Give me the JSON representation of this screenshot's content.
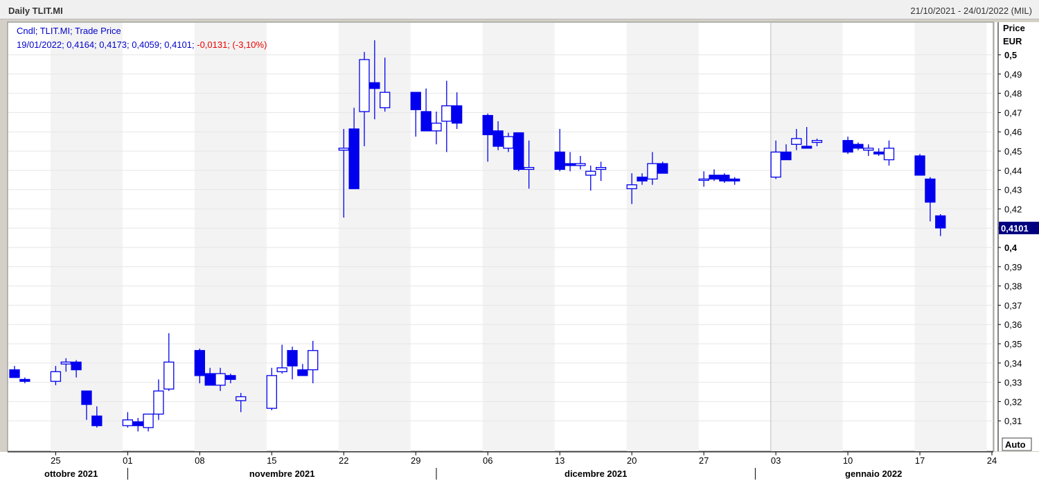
{
  "header": {
    "title": "Daily TLIT.MI",
    "range": "21/10/2021 - 24/01/2022 (MIL)"
  },
  "legend": {
    "line1": "Cndl; TLIT.MI; Trade Price",
    "line2_values": "19/01/2022; 0,4164; 0,4173; 0,4059; 0,4101; ",
    "line2_change": "-0,0131; (-3,10%)"
  },
  "price_axis": {
    "title": "Price",
    "currency": "EUR",
    "last_price": "0,4101",
    "auto_label": "Auto"
  },
  "colors": {
    "candle": "#0000ee",
    "legend_text": "#0000cc",
    "change_text": "#ee0000",
    "last_badge": "#000080"
  },
  "chart_data": {
    "type": "candlestick",
    "title": "Daily TLIT.MI",
    "ylabel": "Price EUR",
    "ylim": [
      0.3,
      0.505
    ],
    "xlim": [
      "2021-10-21",
      "2022-01-24"
    ],
    "y_ticks": [
      "0,31",
      "0,32",
      "0,33",
      "0,34",
      "0,35",
      "0,36",
      "0,37",
      "0,38",
      "0,39",
      "0,4",
      "0,41",
      "0,42",
      "0,43",
      "0,44",
      "0,45",
      "0,46",
      "0,47",
      "0,48",
      "0,49",
      "0,5"
    ],
    "y_ticks_bold": [
      "0,4",
      "0,5"
    ],
    "x_ticks": [
      {
        "date": "2021-10-25",
        "label": "25"
      },
      {
        "date": "2021-11-01",
        "label": "01"
      },
      {
        "date": "2021-11-08",
        "label": "08"
      },
      {
        "date": "2021-11-15",
        "label": "15"
      },
      {
        "date": "2021-11-22",
        "label": "22"
      },
      {
        "date": "2021-11-29",
        "label": "29"
      },
      {
        "date": "2021-12-06",
        "label": "06"
      },
      {
        "date": "2021-12-13",
        "label": "13"
      },
      {
        "date": "2021-12-20",
        "label": "20"
      },
      {
        "date": "2021-12-27",
        "label": "27"
      },
      {
        "date": "2022-01-03",
        "label": "03"
      },
      {
        "date": "2022-01-10",
        "label": "10"
      },
      {
        "date": "2022-01-17",
        "label": "17"
      },
      {
        "date": "2022-01-24",
        "label": "24"
      }
    ],
    "month_labels": [
      {
        "label": "ottobre 2021",
        "start": "2021-10-21",
        "end": "2021-11-01"
      },
      {
        "label": "novembre 2021",
        "start": "2021-11-01",
        "end": "2021-12-01"
      },
      {
        "label": "dicembre 2021",
        "start": "2021-12-01",
        "end": "2022-01-01"
      },
      {
        "label": "gennaio 2022",
        "start": "2022-01-01",
        "end": "2022-01-24"
      }
    ],
    "shaded_weeks": [
      "2021-10-25",
      "2021-11-08",
      "2021-11-22",
      "2021-12-06",
      "2021-12-20",
      "2022-01-03",
      "2022-01-17"
    ],
    "candles": [
      {
        "date": "2021-10-21",
        "open": 0.3365,
        "high": 0.3385,
        "low": 0.3325,
        "close": 0.3325
      },
      {
        "date": "2021-10-22",
        "open": 0.3315,
        "high": 0.3325,
        "low": 0.3295,
        "close": 0.3305
      },
      {
        "date": "2021-10-25",
        "open": 0.3305,
        "high": 0.3385,
        "low": 0.3285,
        "close": 0.3355
      },
      {
        "date": "2021-10-26",
        "open": 0.3395,
        "high": 0.3425,
        "low": 0.3355,
        "close": 0.3405
      },
      {
        "date": "2021-10-27",
        "open": 0.3405,
        "high": 0.3415,
        "low": 0.3325,
        "close": 0.3365
      },
      {
        "date": "2021-10-28",
        "open": 0.3255,
        "high": 0.3255,
        "low": 0.3105,
        "close": 0.3185
      },
      {
        "date": "2021-10-29",
        "open": 0.3125,
        "high": 0.3175,
        "low": 0.3065,
        "close": 0.3075
      },
      {
        "date": "2021-11-01",
        "open": 0.3075,
        "high": 0.3145,
        "low": 0.3065,
        "close": 0.3105
      },
      {
        "date": "2021-11-02",
        "open": 0.3095,
        "high": 0.3115,
        "low": 0.3045,
        "close": 0.3075
      },
      {
        "date": "2021-11-03",
        "open": 0.3065,
        "high": 0.3135,
        "low": 0.3045,
        "close": 0.3135
      },
      {
        "date": "2021-11-04",
        "open": 0.3135,
        "high": 0.3315,
        "low": 0.3105,
        "close": 0.3255
      },
      {
        "date": "2021-11-05",
        "open": 0.3265,
        "high": 0.3555,
        "low": 0.3255,
        "close": 0.3405
      },
      {
        "date": "2021-11-08",
        "open": 0.3465,
        "high": 0.3475,
        "low": 0.3295,
        "close": 0.3335
      },
      {
        "date": "2021-11-09",
        "open": 0.3345,
        "high": 0.3375,
        "low": 0.3285,
        "close": 0.3285
      },
      {
        "date": "2021-11-10",
        "open": 0.3285,
        "high": 0.3375,
        "low": 0.3255,
        "close": 0.3345
      },
      {
        "date": "2021-11-11",
        "open": 0.3335,
        "high": 0.3345,
        "low": 0.3295,
        "close": 0.3315
      },
      {
        "date": "2021-11-12",
        "open": 0.3205,
        "high": 0.3245,
        "low": 0.3145,
        "close": 0.3225
      },
      {
        "date": "2021-11-15",
        "open": 0.3165,
        "high": 0.3375,
        "low": 0.3155,
        "close": 0.3335
      },
      {
        "date": "2021-11-16",
        "open": 0.3355,
        "high": 0.3495,
        "low": 0.3345,
        "close": 0.3375
      },
      {
        "date": "2021-11-17",
        "open": 0.3465,
        "high": 0.3485,
        "low": 0.3315,
        "close": 0.3385
      },
      {
        "date": "2021-11-18",
        "open": 0.3365,
        "high": 0.3395,
        "low": 0.3335,
        "close": 0.3335
      },
      {
        "date": "2021-11-19",
        "open": 0.3365,
        "high": 0.3515,
        "low": 0.3295,
        "close": 0.3465
      },
      {
        "date": "2021-11-22",
        "open": 0.4505,
        "high": 0.4615,
        "low": 0.4155,
        "close": 0.4515
      },
      {
        "date": "2021-11-23",
        "open": 0.4615,
        "high": 0.4725,
        "low": 0.4305,
        "close": 0.4305
      },
      {
        "date": "2021-11-24",
        "open": 0.4705,
        "high": 0.5015,
        "low": 0.4525,
        "close": 0.4975
      },
      {
        "date": "2021-11-25",
        "open": 0.4855,
        "high": 0.5075,
        "low": 0.4665,
        "close": 0.4825
      },
      {
        "date": "2021-11-26",
        "open": 0.4725,
        "high": 0.4985,
        "low": 0.4705,
        "close": 0.4805
      },
      {
        "date": "2021-11-29",
        "open": 0.4805,
        "high": 0.4805,
        "low": 0.4575,
        "close": 0.4715
      },
      {
        "date": "2021-11-30",
        "open": 0.4705,
        "high": 0.4825,
        "low": 0.4605,
        "close": 0.4605
      },
      {
        "date": "2021-12-01",
        "open": 0.4605,
        "high": 0.4705,
        "low": 0.4535,
        "close": 0.4645
      },
      {
        "date": "2021-12-02",
        "open": 0.4655,
        "high": 0.4865,
        "low": 0.4495,
        "close": 0.4735
      },
      {
        "date": "2021-12-03",
        "open": 0.4735,
        "high": 0.4805,
        "low": 0.4615,
        "close": 0.4645
      },
      {
        "date": "2021-12-06",
        "open": 0.4685,
        "high": 0.4695,
        "low": 0.4445,
        "close": 0.4585
      },
      {
        "date": "2021-12-07",
        "open": 0.4605,
        "high": 0.4655,
        "low": 0.4505,
        "close": 0.4525
      },
      {
        "date": "2021-12-08",
        "open": 0.4515,
        "high": 0.4595,
        "low": 0.4495,
        "close": 0.4575
      },
      {
        "date": "2021-12-09",
        "open": 0.4595,
        "high": 0.4595,
        "low": 0.4395,
        "close": 0.4405
      },
      {
        "date": "2021-12-10",
        "open": 0.4405,
        "high": 0.4555,
        "low": 0.4305,
        "close": 0.4415
      },
      {
        "date": "2021-12-13",
        "open": 0.4495,
        "high": 0.4615,
        "low": 0.4395,
        "close": 0.4405
      },
      {
        "date": "2021-12-14",
        "open": 0.4435,
        "high": 0.4495,
        "low": 0.4395,
        "close": 0.4425
      },
      {
        "date": "2021-12-15",
        "open": 0.4425,
        "high": 0.4475,
        "low": 0.4405,
        "close": 0.4435
      },
      {
        "date": "2021-12-16",
        "open": 0.4375,
        "high": 0.4425,
        "low": 0.4295,
        "close": 0.4395
      },
      {
        "date": "2021-12-17",
        "open": 0.4405,
        "high": 0.4445,
        "low": 0.4345,
        "close": 0.4415
      },
      {
        "date": "2021-12-20",
        "open": 0.4305,
        "high": 0.4385,
        "low": 0.4225,
        "close": 0.4325
      },
      {
        "date": "2021-12-21",
        "open": 0.4365,
        "high": 0.4385,
        "low": 0.4325,
        "close": 0.4345
      },
      {
        "date": "2021-12-22",
        "open": 0.4355,
        "high": 0.4495,
        "low": 0.4325,
        "close": 0.4435
      },
      {
        "date": "2021-12-23",
        "open": 0.4435,
        "high": 0.4445,
        "low": 0.4385,
        "close": 0.4385
      },
      {
        "date": "2021-12-27",
        "open": 0.4355,
        "high": 0.4395,
        "low": 0.4315,
        "close": 0.4355
      },
      {
        "date": "2021-12-28",
        "open": 0.4375,
        "high": 0.4405,
        "low": 0.4345,
        "close": 0.4355
      },
      {
        "date": "2021-12-29",
        "open": 0.4375,
        "high": 0.4385,
        "low": 0.4335,
        "close": 0.4345
      },
      {
        "date": "2021-12-30",
        "open": 0.4355,
        "high": 0.4365,
        "low": 0.4325,
        "close": 0.4345
      },
      {
        "date": "2022-01-03",
        "open": 0.4365,
        "high": 0.4555,
        "low": 0.4355,
        "close": 0.4495
      },
      {
        "date": "2022-01-04",
        "open": 0.4495,
        "high": 0.4535,
        "low": 0.4455,
        "close": 0.4455
      },
      {
        "date": "2022-01-05",
        "open": 0.4535,
        "high": 0.4615,
        "low": 0.4505,
        "close": 0.4565
      },
      {
        "date": "2022-01-06",
        "open": 0.4525,
        "high": 0.4625,
        "low": 0.4515,
        "close": 0.4515
      },
      {
        "date": "2022-01-07",
        "open": 0.4545,
        "high": 0.4565,
        "low": 0.4525,
        "close": 0.4555
      },
      {
        "date": "2022-01-10",
        "open": 0.4555,
        "high": 0.4575,
        "low": 0.4485,
        "close": 0.4495
      },
      {
        "date": "2022-01-11",
        "open": 0.4535,
        "high": 0.4545,
        "low": 0.4505,
        "close": 0.4515
      },
      {
        "date": "2022-01-12",
        "open": 0.4505,
        "high": 0.4535,
        "low": 0.4475,
        "close": 0.4515
      },
      {
        "date": "2022-01-13",
        "open": 0.4495,
        "high": 0.4515,
        "low": 0.4475,
        "close": 0.4485
      },
      {
        "date": "2022-01-14",
        "open": 0.4455,
        "high": 0.4555,
        "low": 0.4425,
        "close": 0.4515
      },
      {
        "date": "2022-01-17",
        "open": 0.4475,
        "high": 0.4485,
        "low": 0.4375,
        "close": 0.4375
      },
      {
        "date": "2022-01-18",
        "open": 0.4355,
        "high": 0.4365,
        "low": 0.4135,
        "close": 0.4235
      },
      {
        "date": "2022-01-19",
        "open": 0.4164,
        "high": 0.4173,
        "low": 0.4059,
        "close": 0.4101
      }
    ]
  }
}
